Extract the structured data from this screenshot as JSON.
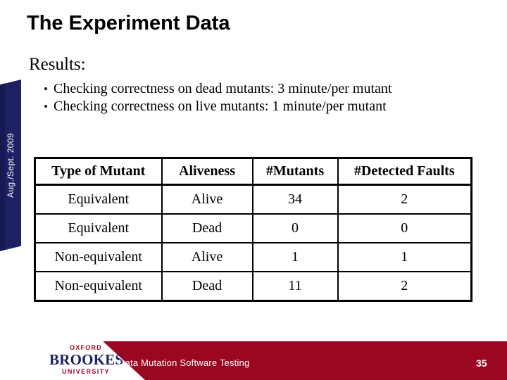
{
  "slide": {
    "title": "The Experiment Data",
    "section_label": "Results:",
    "bullets": [
      {
        "marker": "•",
        "text": "Checking correctness on dead mutants: 3 minute/per mutant"
      },
      {
        "marker": "•",
        "text": "Checking correctness on live mutants: 1 minute/per mutant"
      }
    ]
  },
  "side_tab": {
    "label": "Aug./Sept. 2009",
    "color": "#1d2164"
  },
  "table": {
    "headers": [
      "Type of Mutant",
      "Aliveness",
      "#Mutants",
      "#Detected Faults"
    ],
    "rows": [
      [
        "Equivalent",
        "Alive",
        "34",
        "2"
      ],
      [
        "Equivalent",
        "Dead",
        "0",
        "0"
      ],
      [
        "Non-equivalent",
        "Alive",
        "1",
        "1"
      ],
      [
        "Non-equivalent",
        "Dead",
        "11",
        "2"
      ]
    ]
  },
  "footer": {
    "text": "Data Mutation Software Testing",
    "page_number": "35",
    "band_color": "#9b0721",
    "logo": {
      "top": "OXFORD",
      "main": "BROOKES",
      "bottom": "UNIVERSITY",
      "accent_color": "#9b0721",
      "main_color": "#1d2164"
    }
  }
}
